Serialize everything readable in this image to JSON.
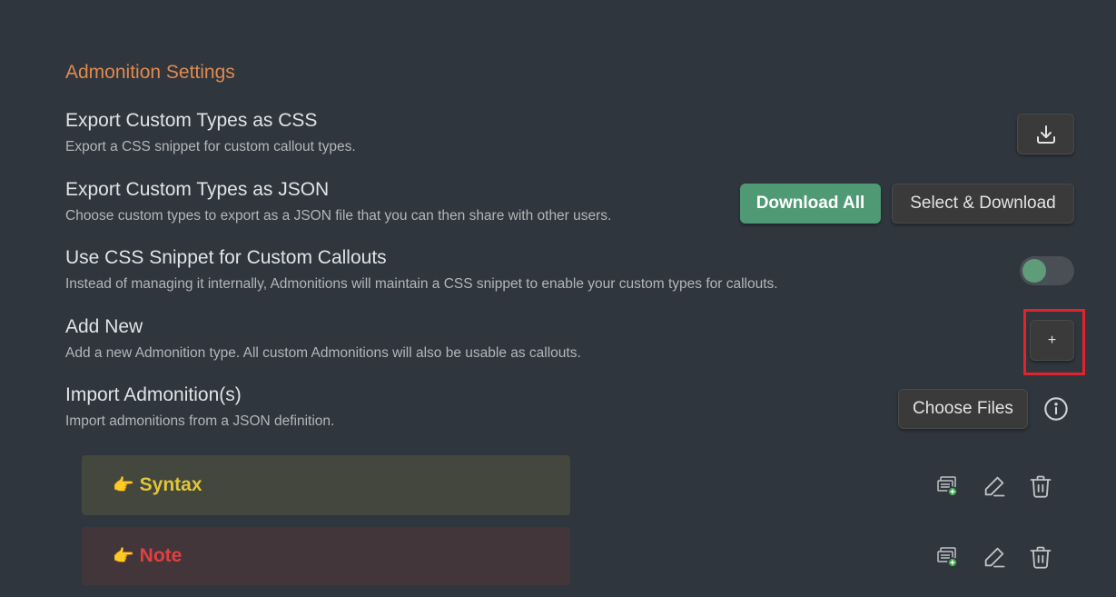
{
  "heading": "Admonition Settings",
  "settings": {
    "export_css": {
      "name": "Export Custom Types as CSS",
      "desc": "Export a CSS snippet for custom callout types.",
      "button_icon": "download-icon"
    },
    "export_json": {
      "name": "Export Custom Types as JSON",
      "desc": "Choose custom types to export as a JSON file that you can then share with other users.",
      "download_all": "Download All",
      "select_download": "Select & Download"
    },
    "css_snippet": {
      "name": "Use CSS Snippet for Custom Callouts",
      "desc": "Instead of managing it internally, Admonitions will maintain a CSS snippet to enable your custom types for callouts.",
      "enabled": false
    },
    "add_new": {
      "name": "Add New",
      "desc": "Add a new Admonition type. All custom Admonitions will also be usable as callouts.",
      "button": "+"
    },
    "import": {
      "name": "Import Admonition(s)",
      "desc": "Import admonitions from a JSON definition.",
      "button": "Choose Files",
      "info_icon": "info-icon"
    }
  },
  "admonitions": [
    {
      "emoji": "👉",
      "label": "Syntax",
      "color": "#e0c53a"
    },
    {
      "emoji": "👉",
      "label": "Note",
      "color": "#e04040"
    }
  ],
  "colors": {
    "accent": "#e0894f",
    "primary_button": "#4f9a74",
    "highlight": "#e3232b"
  }
}
